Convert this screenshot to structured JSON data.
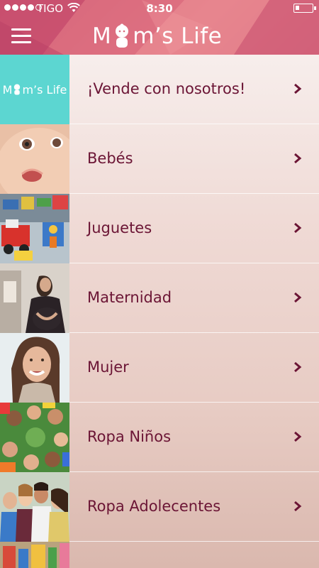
{
  "status_bar": {
    "carrier": "TIGO",
    "time": "8:30"
  },
  "header": {
    "logo_text_m": "M",
    "logo_text_rest": "m’s Life"
  },
  "menu": {
    "items": [
      {
        "label": "¡Vende con nosotros!",
        "thumb": "mom-life-logo"
      },
      {
        "label": "Bebés",
        "thumb": "baby-photo"
      },
      {
        "label": "Juguetes",
        "thumb": "toys-photo"
      },
      {
        "label": "Maternidad",
        "thumb": "pregnant-woman-photo"
      },
      {
        "label": "Mujer",
        "thumb": "smiling-woman-photo"
      },
      {
        "label": "Ropa Niños",
        "thumb": "children-circle-photo"
      },
      {
        "label": "Ropa Adolecentes",
        "thumb": "teenagers-photo"
      }
    ]
  },
  "thumb_logo": {
    "text_m": "M",
    "text_rest": "m’s Life"
  },
  "colors": {
    "accent": "#6b1535",
    "header_pink": "#d96a7d",
    "logo_teal": "#5cd6d1"
  }
}
